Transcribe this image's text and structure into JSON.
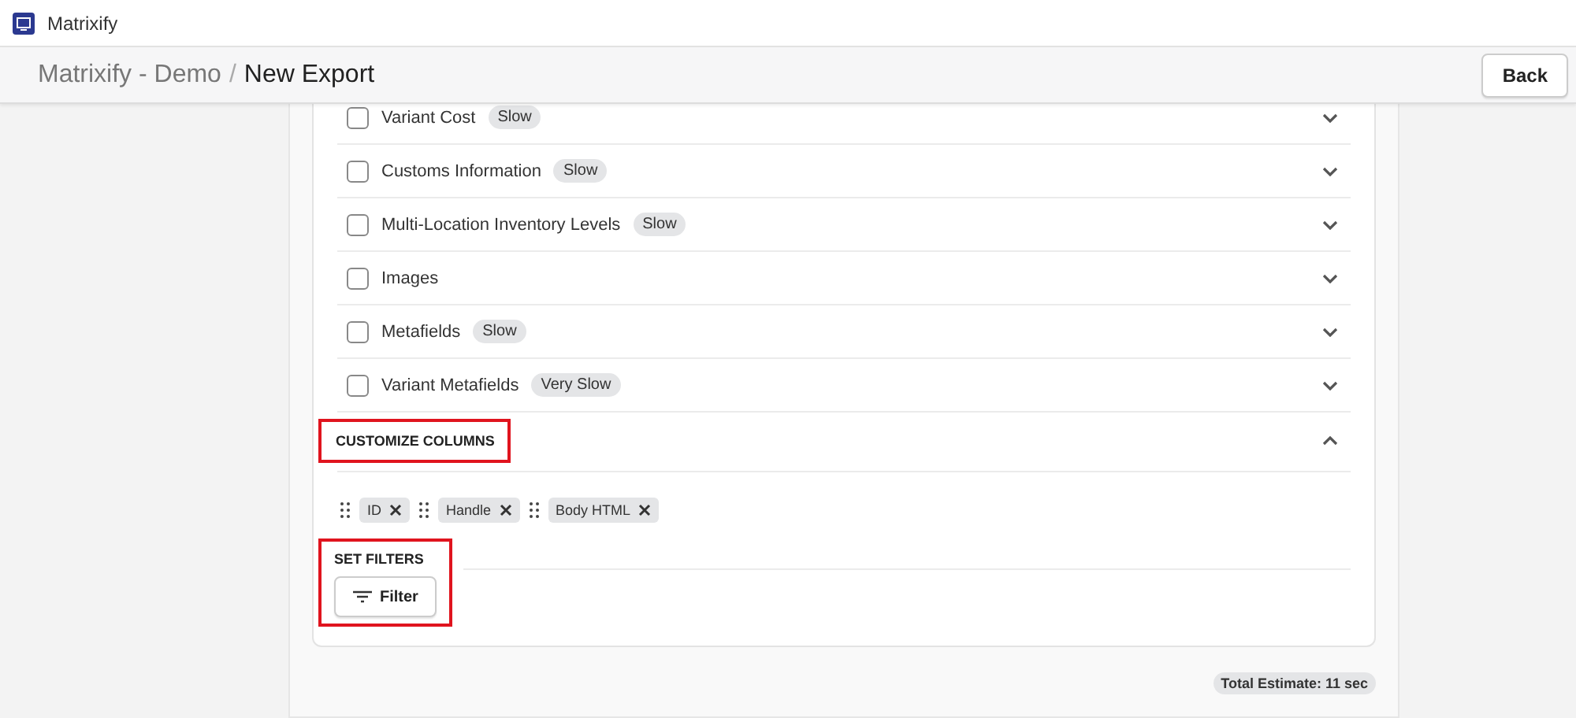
{
  "app": {
    "name": "Matrixify"
  },
  "header": {
    "breadcrumb": "Matrixify - Demo",
    "separator": "/",
    "title": "New Export",
    "back_button": "Back"
  },
  "options": [
    {
      "label": "Variant Cost",
      "badge": "Slow",
      "checked": false,
      "expanded": false
    },
    {
      "label": "Customs Information",
      "badge": "Slow",
      "checked": false,
      "expanded": false
    },
    {
      "label": "Multi-Location Inventory Levels",
      "badge": "Slow",
      "checked": false,
      "expanded": false
    },
    {
      "label": "Images",
      "checked": false,
      "expanded": false
    },
    {
      "label": "Metafields",
      "badge": "Slow",
      "checked": false,
      "expanded": false
    },
    {
      "label": "Variant Metafields",
      "badge": "Very Slow",
      "checked": false,
      "expanded": false
    }
  ],
  "customize_columns": {
    "title": "CUSTOMIZE COLUMNS",
    "expanded": true,
    "highlighted": true,
    "columns": [
      "ID",
      "Handle",
      "Body HTML"
    ]
  },
  "set_filters": {
    "title": "SET FILTERS",
    "highlighted": true,
    "filter_button": "Filter"
  },
  "total_estimate": "Total Estimate: 11 sec"
}
